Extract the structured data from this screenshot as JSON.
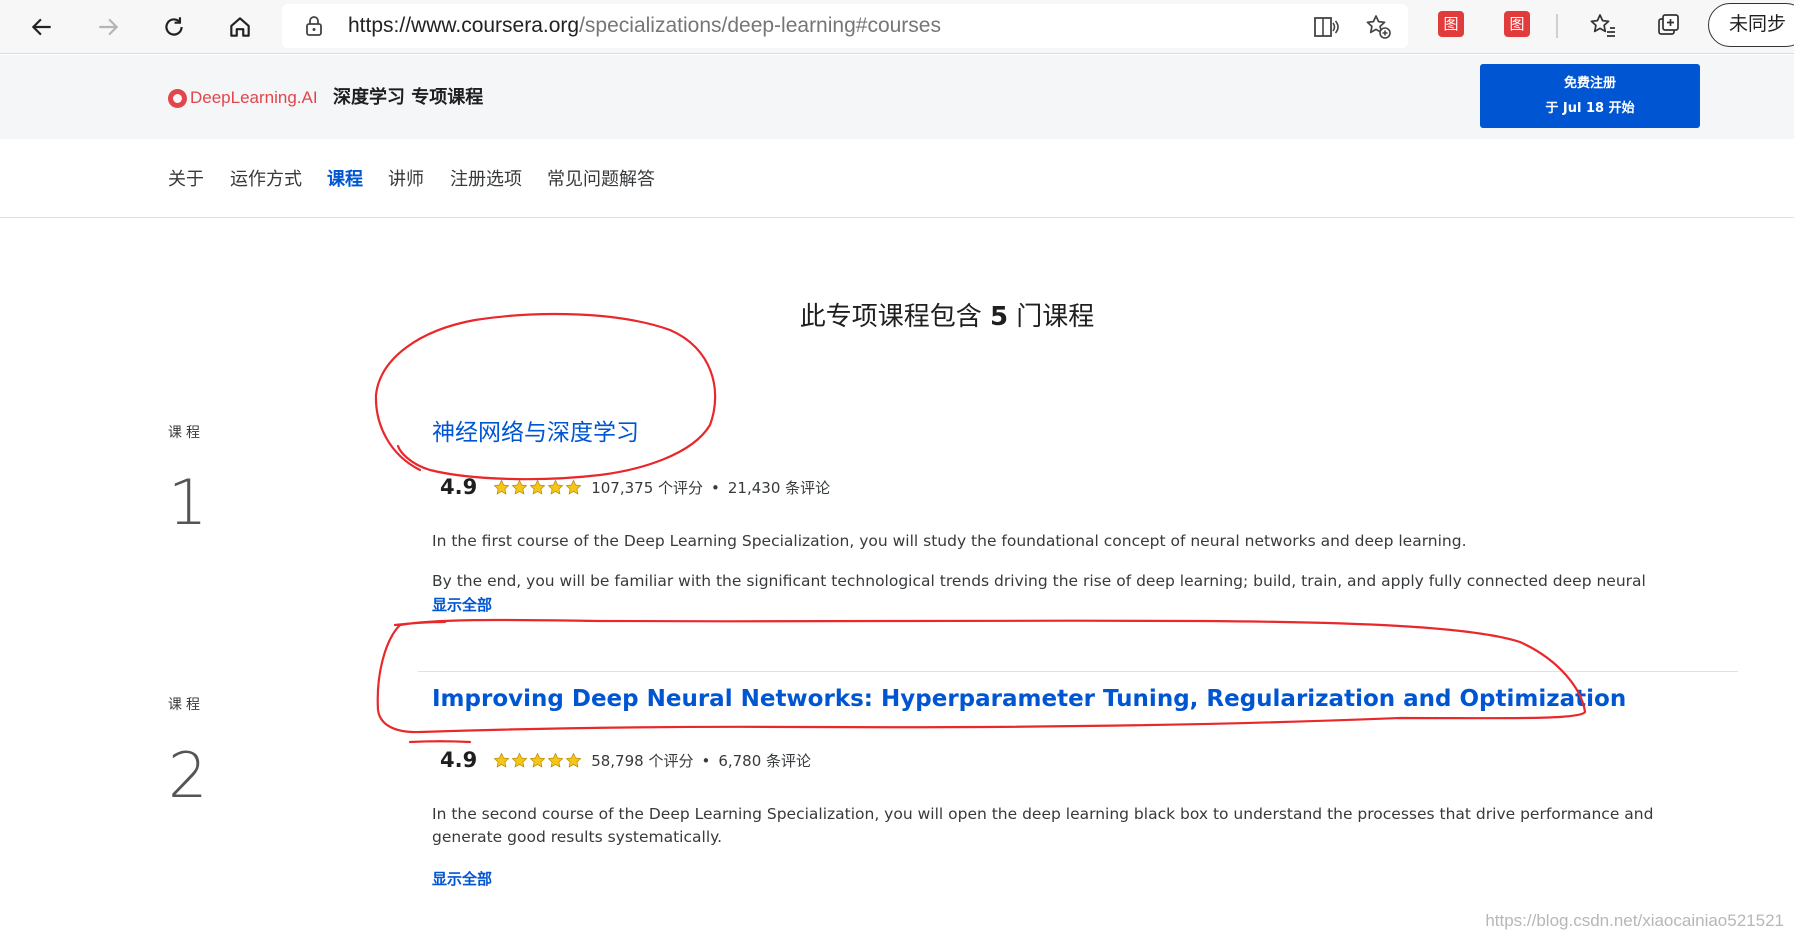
{
  "browser": {
    "url_host": "https://www.coursera.org",
    "url_path": "/specializations/deep-learning#courses",
    "ext1_label": "图",
    "ext2_label": "图",
    "profile_label": "未同步"
  },
  "header": {
    "brand_name": "DeepLearning.AI",
    "spec_title": "深度学习 专项课程",
    "enroll_line1": "免费注册",
    "enroll_line2": "于 Jul 18 开始"
  },
  "nav": {
    "items": [
      {
        "label": "关于"
      },
      {
        "label": "运作方式"
      },
      {
        "label": "课程"
      },
      {
        "label": "讲师"
      },
      {
        "label": "注册选项"
      },
      {
        "label": "常见问题解答"
      }
    ],
    "active_index": 2
  },
  "section": {
    "heading_prefix": "此专项课程包含 ",
    "heading_count": "5",
    "heading_suffix": " 门课程"
  },
  "courses": [
    {
      "label": "课程",
      "number": "1",
      "title": "神经网络与深度学习",
      "rating": "4.9",
      "stars": 5,
      "ratings_count": "107,375 个评分",
      "reviews_count": "21,430 条评论",
      "desc1": "In the first course of the Deep Learning Specialization, you will study the foundational concept of neural networks and deep learning.",
      "desc2": "By the end, you will be familiar with the significant technological trends driving the rise of deep learning; build, train, and apply fully connected deep neural networks; implement",
      "show_all": "显示全部"
    },
    {
      "label": "课程",
      "number": "2",
      "title": "Improving Deep Neural Networks: Hyperparameter Tuning, Regularization and Optimization",
      "rating": "4.9",
      "stars": 5,
      "ratings_count": "58,798 个评分",
      "reviews_count": "6,780 条评论",
      "desc1": "In the second course of the Deep Learning Specialization, you will open the deep learning black box to understand the processes that drive performance and generate good results systematically.",
      "show_all": "显示全部"
    }
  ],
  "rating_separator": "•",
  "watermark": "https://blog.csdn.net/xiaocainiao521521",
  "colors": {
    "accent": "#0056d2",
    "brand": "#e0464b",
    "star": "#f5c518",
    "annotation": "#e8282b"
  }
}
